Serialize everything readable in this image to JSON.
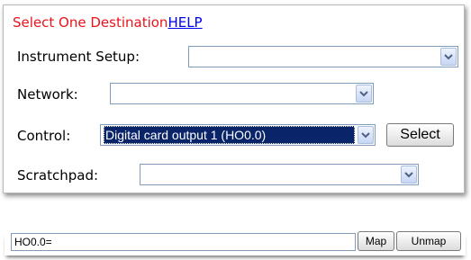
{
  "panel": {
    "title": "Select One Destination",
    "help_link": "HELP"
  },
  "fields": {
    "instrument_setup": {
      "label": "Instrument Setup:",
      "value": ""
    },
    "network": {
      "label": "Network:",
      "value": ""
    },
    "control": {
      "label": "Control:",
      "value": "Digital card output 1 (HO0.0)"
    },
    "scratchpad": {
      "label": "Scratchpad:",
      "value": ""
    }
  },
  "select_button": "Select",
  "mapping": {
    "value": "HO0.0=",
    "map_button": "Map",
    "unmap_button": "Unmap"
  },
  "colors": {
    "title": "#e8141b",
    "link": "#0000ee",
    "selection_bg": "#0a246a"
  }
}
